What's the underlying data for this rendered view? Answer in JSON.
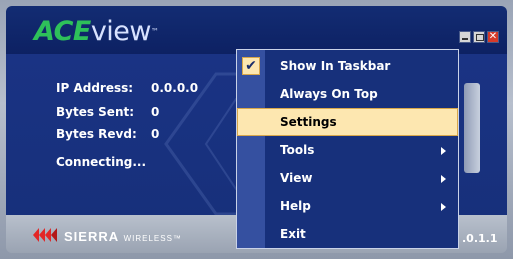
{
  "app": {
    "logo_ace": "ACE",
    "logo_view": "view",
    "logo_tm": "™"
  },
  "window_controls": {
    "close_glyph": "✕"
  },
  "status": {
    "ip_label": "IP Address:",
    "ip_value": "0.0.0.0",
    "sent_label": "Bytes Sent:",
    "sent_value": "0",
    "recv_label": "Bytes Revd:",
    "recv_value": "0",
    "connection": "Connecting..."
  },
  "footer": {
    "brand_sierra": "SIERRA",
    "brand_wireless": "WIRELESS",
    "brand_tm": "™",
    "version": ".0.1.1"
  },
  "menu": {
    "check_glyph": "✔",
    "items": [
      {
        "label": "Show In Taskbar",
        "checked": true,
        "submenu": false
      },
      {
        "label": "Always On Top",
        "checked": false,
        "submenu": false
      },
      {
        "label": "Settings",
        "checked": false,
        "submenu": false,
        "selected": true
      },
      {
        "label": "Tools",
        "checked": false,
        "submenu": true
      },
      {
        "label": "View",
        "checked": false,
        "submenu": true
      },
      {
        "label": "Help",
        "checked": false,
        "submenu": true
      },
      {
        "label": "Exit",
        "checked": false,
        "submenu": false
      }
    ]
  },
  "colors": {
    "ace_green": "#2ec05a",
    "content_blue": "#17307b",
    "highlight": "#fde7b0"
  }
}
